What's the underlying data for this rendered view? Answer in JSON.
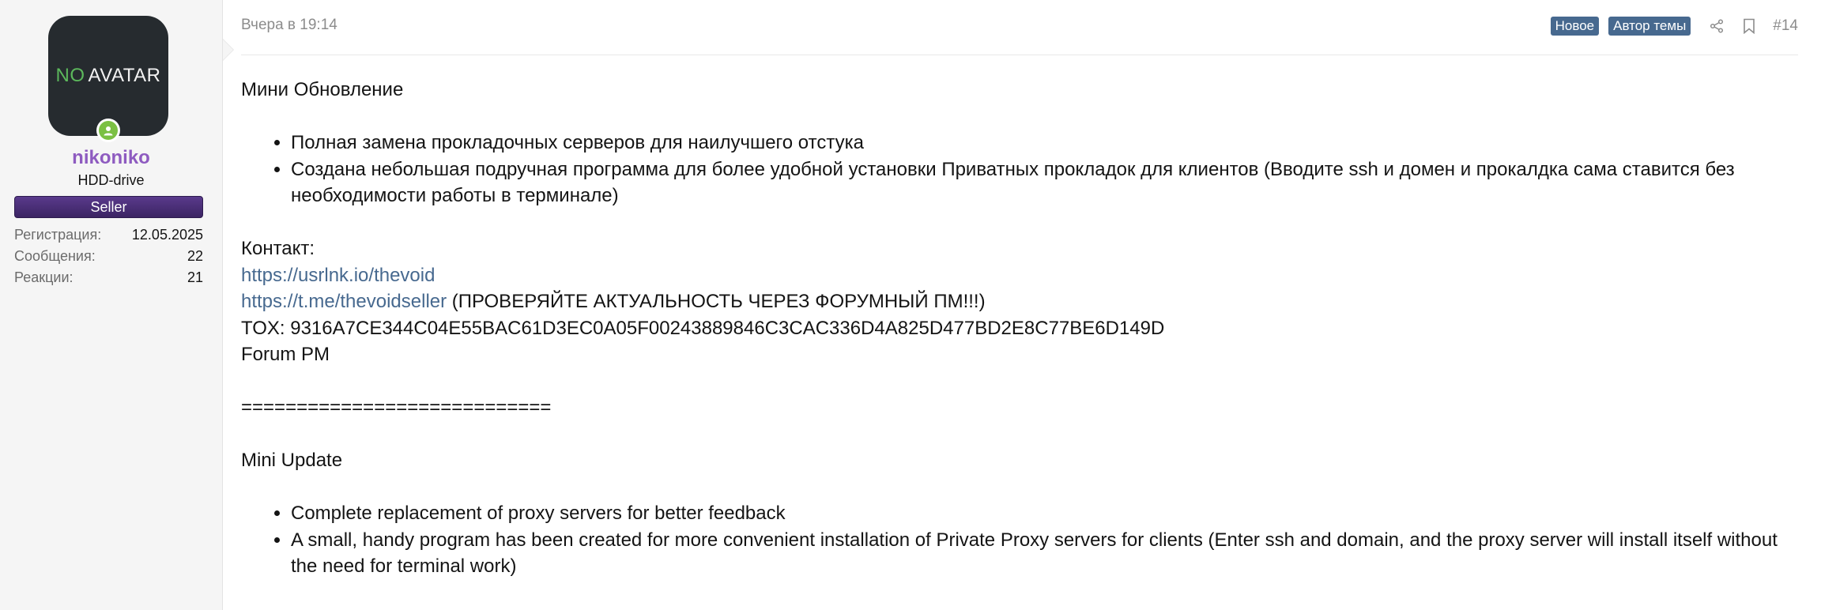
{
  "user": {
    "avatar_text_no": "NO",
    "avatar_text_avatar": "AVATAR",
    "username": "nikoniko",
    "title": "HDD-drive",
    "banner": "Seller",
    "stats": [
      {
        "label": "Регистрация:",
        "value": "12.05.2025"
      },
      {
        "label": "Сообщения:",
        "value": "22"
      },
      {
        "label": "Реакции:",
        "value": "21"
      }
    ]
  },
  "post": {
    "date": "Вчера в 19:14",
    "label_new": "Новое",
    "label_author": "Автор темы",
    "number": "#14",
    "icons": [
      "share-icon",
      "bookmark-icon"
    ],
    "colors": {
      "link": "#47698f",
      "username": "#8e5bc0",
      "online": "#7bc043",
      "banner": "#4a2e78"
    },
    "body": {
      "ru_title": "Мини Обновление",
      "ru_items": [
        "Полная замена прокладочных серверов для наилучшего отстука",
        "Создана небольшая подручная программа для более удобной установки Приватных прокладок для клиентов (Вводите ssh и домен и прокалдка сама ставится без необходимости работы в терминале)"
      ],
      "contact_label": "Контакт:",
      "link1": "https://usrlnk.io/thevoid",
      "link2": "https://t.me/thevoidseller",
      "link2_note": " (ПРОВЕРЯЙТЕ АКТУАЛЬНОСТЬ ЧЕРЕЗ ФОРУМНЫЙ ПМ!!!)",
      "tox": "TOX: 9316A7CE344C04E55BAC61D3EC0A05F00243889846C3CAC336D4A825D477BD2E8C77BE6D149D",
      "forum_pm": "Forum PM",
      "separator": "============================",
      "en_title": "Mini Update",
      "en_items": [
        "Complete replacement of proxy servers for better feedback",
        "A small, handy program has been created for more convenient installation of Private Proxy servers for clients (Enter ssh and domain, and the proxy server will install itself without the need for terminal work)"
      ]
    }
  }
}
